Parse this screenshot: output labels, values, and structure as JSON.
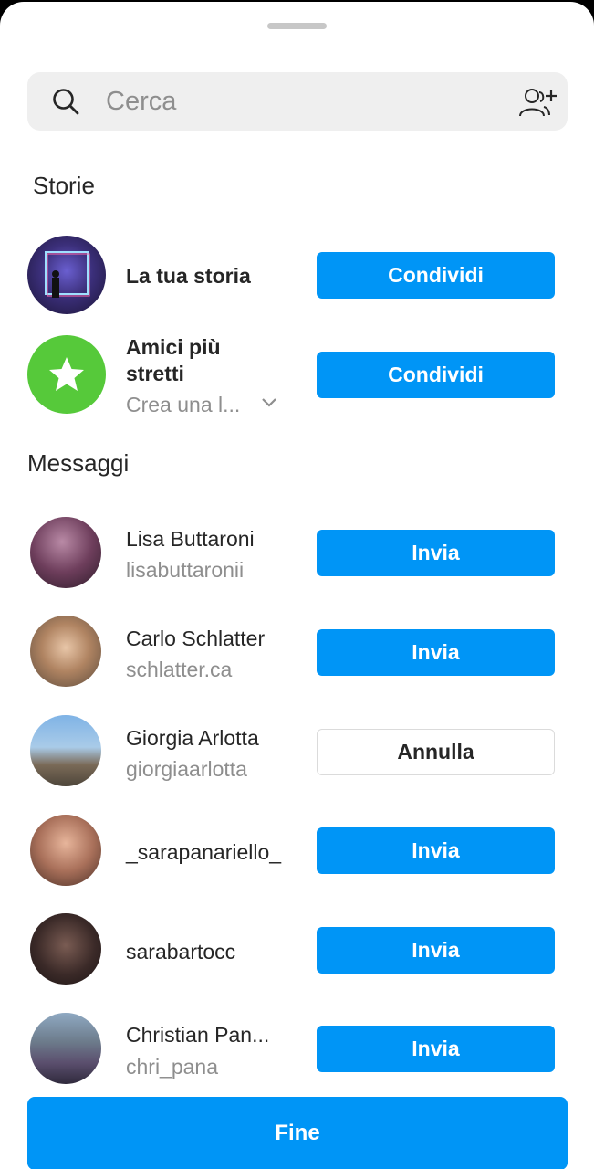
{
  "search": {
    "placeholder": "Cerca",
    "icon": "search-icon",
    "action_icon": "add-person-icon"
  },
  "stories": {
    "title": "Storie",
    "items": [
      {
        "name": "La tua storia",
        "button": "Condividi"
      },
      {
        "name": "Amici più stretti",
        "subtitle": "Crea una l...",
        "button": "Condividi"
      }
    ]
  },
  "messages": {
    "title": "Messaggi",
    "items": [
      {
        "name": "Lisa Buttaroni",
        "username": "lisabuttaronii",
        "button": "Invia"
      },
      {
        "name": "Carlo Schlatter",
        "username": "schlatter.ca",
        "button": "Invia"
      },
      {
        "name": "Giorgia Arlotta",
        "username": "giorgiaarlotta",
        "button": "Annulla"
      },
      {
        "name": "_sarapanariello_",
        "username": "",
        "button": "Invia"
      },
      {
        "name": "sarabartocc",
        "username": "",
        "button": "Invia"
      },
      {
        "name": "Christian Pan...",
        "username": "chri_pana",
        "button": "Invia"
      }
    ]
  },
  "footer": {
    "done_label": "Fine"
  },
  "colors": {
    "accent": "#0095f6",
    "close_friends": "#56c93a",
    "muted_text": "#8e8e8e"
  }
}
